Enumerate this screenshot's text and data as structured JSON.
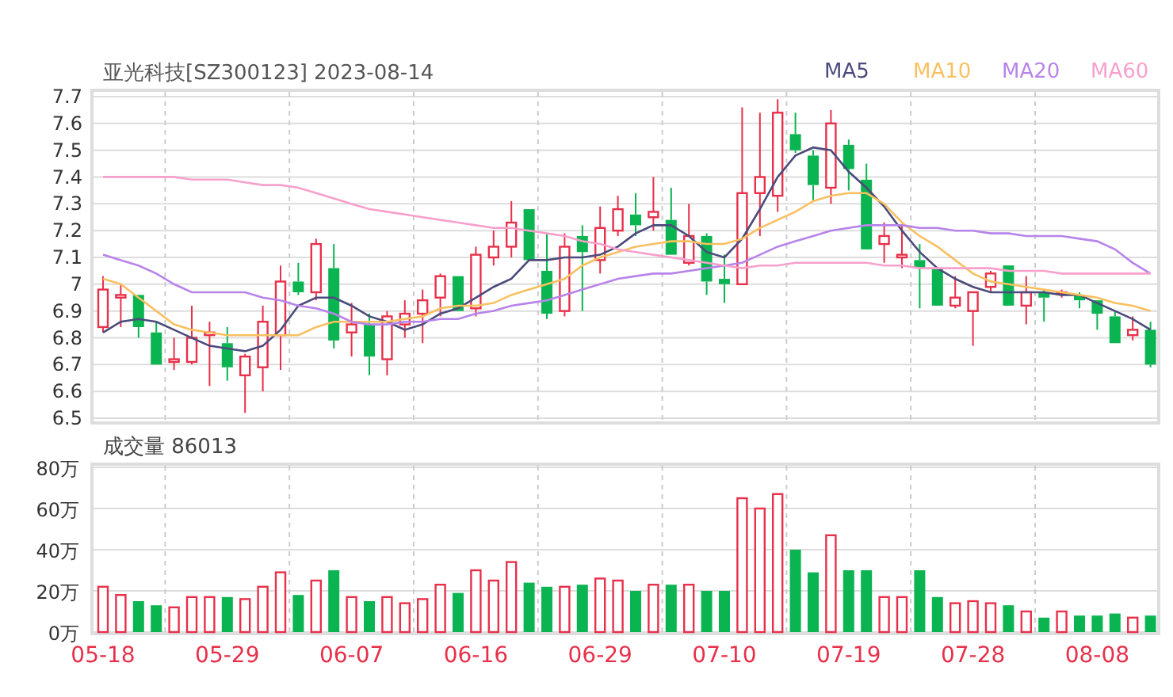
{
  "header": {
    "title": "亚光科技[SZ300123] 2023-08-14"
  },
  "price_chart": {
    "chart_data": {
      "type": "candlestick",
      "grid": true,
      "ylim": [
        6.5,
        7.7
      ],
      "yticks": [
        6.5,
        6.6,
        6.7,
        6.8,
        6.9,
        {
          "value": 7,
          "label": "7"
        },
        7.1,
        7.2,
        7.3,
        7.4,
        7.5,
        7.6,
        7.7
      ],
      "series": [
        {
          "name": "MA5",
          "type": "line",
          "color": "#4b4b7c",
          "values": [
            6.82,
            6.86,
            6.87,
            6.86,
            6.83,
            6.8,
            6.77,
            6.76,
            6.75,
            6.77,
            6.83,
            6.92,
            6.95,
            6.95,
            6.92,
            6.88,
            6.86,
            6.83,
            6.85,
            6.89,
            6.91,
            6.95,
            6.99,
            7.02,
            7.09,
            7.09,
            7.1,
            7.1,
            7.11,
            7.14,
            7.19,
            7.22,
            7.22,
            7.18,
            7.12,
            7.1,
            7.17,
            7.28,
            7.4,
            7.48,
            7.51,
            7.5,
            7.42,
            7.36,
            7.29,
            7.2,
            7.12,
            7.06,
            7.02,
            6.99,
            6.97,
            6.97,
            6.97,
            6.97,
            6.96,
            6.96,
            6.93,
            6.9,
            6.87,
            6.83
          ]
        },
        {
          "name": "MA10",
          "type": "line",
          "color": "#f8c060",
          "values": [
            7.02,
            7.0,
            6.95,
            6.9,
            6.85,
            6.83,
            6.82,
            6.81,
            6.81,
            6.81,
            6.81,
            6.81,
            6.84,
            6.86,
            6.86,
            6.86,
            6.86,
            6.87,
            6.88,
            6.91,
            6.92,
            6.92,
            6.93,
            6.96,
            6.98,
            7.0,
            7.02,
            7.07,
            7.1,
            7.12,
            7.14,
            7.15,
            7.16,
            7.16,
            7.15,
            7.15,
            7.17,
            7.21,
            7.24,
            7.27,
            7.31,
            7.33,
            7.34,
            7.34,
            7.3,
            7.23,
            7.18,
            7.14,
            7.09,
            7.04,
            7.01,
            7.0,
            6.99,
            6.98,
            6.97,
            6.96,
            6.95,
            6.93,
            6.92,
            6.9
          ]
        },
        {
          "name": "MA20",
          "type": "line",
          "color": "#b784ea",
          "values": [
            7.11,
            7.09,
            7.07,
            7.04,
            7.0,
            6.97,
            6.97,
            6.97,
            6.97,
            6.95,
            6.94,
            6.92,
            6.91,
            6.89,
            6.86,
            6.85,
            6.85,
            6.86,
            6.86,
            6.87,
            6.87,
            6.89,
            6.9,
            6.92,
            6.93,
            6.94,
            6.96,
            6.98,
            7.0,
            7.02,
            7.03,
            7.04,
            7.04,
            7.05,
            7.06,
            7.07,
            7.08,
            7.11,
            7.14,
            7.16,
            7.18,
            7.2,
            7.21,
            7.22,
            7.22,
            7.22,
            7.21,
            7.21,
            7.2,
            7.2,
            7.19,
            7.19,
            7.18,
            7.18,
            7.18,
            7.17,
            7.16,
            7.13,
            7.08,
            7.04
          ]
        },
        {
          "name": "MA60",
          "type": "line",
          "color": "#f7a0cc",
          "values": [
            7.4,
            7.4,
            7.4,
            7.4,
            7.4,
            7.39,
            7.39,
            7.39,
            7.38,
            7.37,
            7.37,
            7.36,
            7.34,
            7.32,
            7.3,
            7.28,
            7.27,
            7.26,
            7.25,
            7.24,
            7.23,
            7.22,
            7.21,
            7.21,
            7.2,
            7.19,
            7.18,
            7.16,
            7.15,
            7.13,
            7.12,
            7.11,
            7.1,
            7.09,
            7.08,
            7.07,
            7.06,
            7.07,
            7.07,
            7.08,
            7.08,
            7.08,
            7.08,
            7.08,
            7.07,
            7.07,
            7.06,
            7.06,
            7.06,
            7.06,
            7.06,
            7.05,
            7.05,
            7.05,
            7.04,
            7.04,
            7.04,
            7.04,
            7.04,
            7.04
          ]
        }
      ],
      "ohlc": [
        [
          6.84,
          7.03,
          6.82,
          6.98
        ],
        [
          6.95,
          7.0,
          6.84,
          6.96
        ],
        [
          6.96,
          6.96,
          6.8,
          6.84
        ],
        [
          6.82,
          6.86,
          6.7,
          6.7
        ],
        [
          6.71,
          6.8,
          6.68,
          6.72
        ],
        [
          6.71,
          6.92,
          6.7,
          6.8
        ],
        [
          6.81,
          6.86,
          6.62,
          6.82
        ],
        [
          6.78,
          6.84,
          6.64,
          6.69
        ],
        [
          6.66,
          6.74,
          6.52,
          6.73
        ],
        [
          6.69,
          6.92,
          6.6,
          6.86
        ],
        [
          6.81,
          7.07,
          6.68,
          7.01
        ],
        [
          7.01,
          7.08,
          6.96,
          6.97
        ],
        [
          6.97,
          7.17,
          6.94,
          7.15
        ],
        [
          7.06,
          7.15,
          6.76,
          6.79
        ],
        [
          6.82,
          6.93,
          6.73,
          6.85
        ],
        [
          6.85,
          6.89,
          6.66,
          6.73
        ],
        [
          6.72,
          6.9,
          6.66,
          6.88
        ],
        [
          6.85,
          6.94,
          6.8,
          6.89
        ],
        [
          6.89,
          6.98,
          6.78,
          6.94
        ],
        [
          6.95,
          7.04,
          6.88,
          7.03
        ],
        [
          7.03,
          7.03,
          6.9,
          6.9
        ],
        [
          6.91,
          7.14,
          6.88,
          7.11
        ],
        [
          7.1,
          7.2,
          7.07,
          7.14
        ],
        [
          7.14,
          7.31,
          7.1,
          7.23
        ],
        [
          7.28,
          7.28,
          7.09,
          7.09
        ],
        [
          7.05,
          7.19,
          6.87,
          6.89
        ],
        [
          6.9,
          7.19,
          6.88,
          7.14
        ],
        [
          7.18,
          7.22,
          6.9,
          7.12
        ],
        [
          7.09,
          7.29,
          7.04,
          7.21
        ],
        [
          7.2,
          7.33,
          7.18,
          7.28
        ],
        [
          7.26,
          7.34,
          7.18,
          7.22
        ],
        [
          7.25,
          7.4,
          7.2,
          7.27
        ],
        [
          7.24,
          7.36,
          7.11,
          7.11
        ],
        [
          7.08,
          7.3,
          7.07,
          7.18
        ],
        [
          7.18,
          7.19,
          6.96,
          7.01
        ],
        [
          7.02,
          7.11,
          6.93,
          7.0
        ],
        [
          7.0,
          7.66,
          7.0,
          7.34
        ],
        [
          7.34,
          7.64,
          7.18,
          7.4
        ],
        [
          7.33,
          7.69,
          7.27,
          7.64
        ],
        [
          7.56,
          7.64,
          7.49,
          7.5
        ],
        [
          7.48,
          7.5,
          7.31,
          7.37
        ],
        [
          7.36,
          7.65,
          7.3,
          7.6
        ],
        [
          7.52,
          7.54,
          7.35,
          7.43
        ],
        [
          7.39,
          7.45,
          7.13,
          7.13
        ],
        [
          7.15,
          7.23,
          7.08,
          7.18
        ],
        [
          7.1,
          7.22,
          7.06,
          7.11
        ],
        [
          7.09,
          7.15,
          6.91,
          7.06
        ],
        [
          7.06,
          7.06,
          6.92,
          6.92
        ],
        [
          6.92,
          7.03,
          6.91,
          6.95
        ],
        [
          6.9,
          6.97,
          6.77,
          6.97
        ],
        [
          6.99,
          7.05,
          6.97,
          7.04
        ],
        [
          7.07,
          7.07,
          6.92,
          6.92
        ],
        [
          6.92,
          7.03,
          6.85,
          6.97
        ],
        [
          6.97,
          6.98,
          6.86,
          6.95
        ],
        [
          6.97,
          6.98,
          6.95,
          6.97
        ],
        [
          6.96,
          6.97,
          6.91,
          6.94
        ],
        [
          6.94,
          6.94,
          6.83,
          6.89
        ],
        [
          6.88,
          6.9,
          6.78,
          6.78
        ],
        [
          6.81,
          6.88,
          6.79,
          6.83
        ],
        [
          6.83,
          6.86,
          6.69,
          6.7
        ]
      ]
    }
  },
  "volume_chart": {
    "label": "成交量 86013",
    "chart_data": {
      "type": "bar",
      "stacked": true,
      "grid": true,
      "ylim": [
        0,
        80
      ],
      "yticks": [
        {
          "value": 0,
          "label": "0万"
        },
        {
          "value": 20,
          "label": "20万"
        },
        {
          "value": 40,
          "label": "40万"
        },
        {
          "value": 60,
          "label": "60万"
        },
        {
          "value": 80,
          "label": "80万"
        }
      ],
      "categories": [
        "05-18",
        null,
        null,
        null,
        null,
        null,
        null,
        "05-29",
        null,
        null,
        null,
        null,
        null,
        null,
        "06-07",
        null,
        null,
        null,
        null,
        null,
        null,
        "06-16",
        null,
        null,
        null,
        null,
        null,
        null,
        "06-29",
        null,
        null,
        null,
        null,
        null,
        null,
        "07-10",
        null,
        null,
        null,
        null,
        null,
        null,
        "07-19",
        null,
        null,
        null,
        null,
        null,
        null,
        "07-28",
        null,
        null,
        null,
        null,
        null,
        null,
        "08-08",
        null,
        null,
        null
      ],
      "series": [
        {
          "color": "#e8304a",
          "values": [
            22,
            18,
            null,
            null,
            12,
            17,
            17,
            null,
            16,
            22,
            29,
            null,
            25,
            null,
            17,
            null,
            17,
            14,
            16,
            23,
            null,
            30,
            25,
            34,
            null,
            null,
            22,
            null,
            26,
            25,
            null,
            23,
            null,
            23,
            null,
            null,
            65,
            60,
            67,
            null,
            null,
            47,
            null,
            null,
            17,
            17,
            null,
            null,
            14,
            15,
            14,
            null,
            10,
            null,
            10,
            null,
            null,
            null,
            7,
            null
          ]
        },
        {
          "color": "#0ab450",
          "values": [
            null,
            null,
            15,
            13,
            null,
            null,
            null,
            17,
            null,
            null,
            null,
            18,
            null,
            30,
            null,
            15,
            null,
            null,
            null,
            null,
            19,
            null,
            null,
            null,
            24,
            22,
            null,
            23,
            null,
            null,
            20,
            null,
            23,
            null,
            20,
            20,
            null,
            null,
            null,
            40,
            29,
            null,
            30,
            30,
            null,
            null,
            30,
            17,
            null,
            null,
            null,
            13,
            null,
            7,
            null,
            8,
            8,
            9,
            null,
            8
          ]
        }
      ]
    }
  }
}
